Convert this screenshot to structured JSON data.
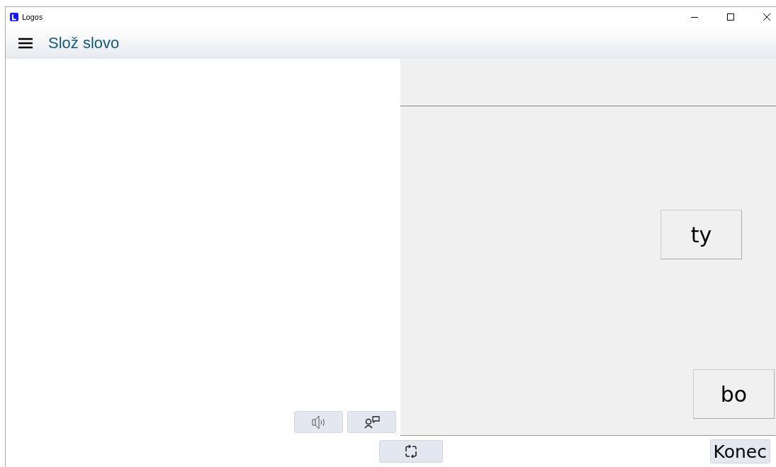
{
  "window": {
    "title": "Logos"
  },
  "header": {
    "title": "Slož slovo"
  },
  "tiles": [
    {
      "label": "ty"
    },
    {
      "label": "bo"
    }
  ],
  "footer": {
    "end_button": "Konec"
  }
}
